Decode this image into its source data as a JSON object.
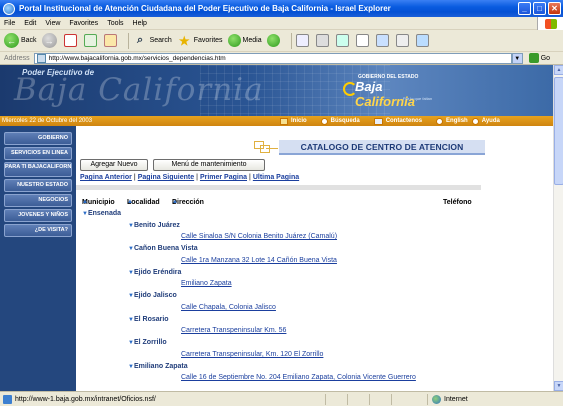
{
  "window": {
    "title": "Portal Institucional de Atención Ciudadana del Poder Ejecutivo de Baja California - Israel Explorer",
    "controls": {
      "minimize": "_",
      "maximize": "□",
      "close": "✕"
    }
  },
  "menu": [
    "File",
    "Edit",
    "View",
    "Favorites",
    "Tools",
    "Help"
  ],
  "toolbar": {
    "back": "Back",
    "search": "Search",
    "favorites": "Favorites",
    "media": "Media"
  },
  "address": {
    "label": "Address",
    "url": "http://www.bajacalifornia.gob.mx/servicios_dependencias.htm",
    "go": "Go"
  },
  "banner": {
    "subtitle": "Poder Ejecutivo de",
    "bg_text": "Baja California",
    "logo_gob": "GOBIERNO DEL ESTADO",
    "logo_baja": "Baja",
    "logo_california": "California",
    "logo_tag": "Por lo que faltan"
  },
  "navstrip": {
    "date": "Miercoles 22 de Octubre del 2003",
    "items": [
      "Inicio",
      "Búsqueda",
      "Contactenos",
      "English",
      "Ayuda"
    ]
  },
  "sidebar": [
    "GOBIERNO",
    "SERVICIOS EN LINEA",
    "PARA TI BAJACALIFORNIANO",
    "NUESTRO ESTADO",
    "NEGOCIOS",
    "JOVENES Y NIÑOS",
    "¿DE VISITA?"
  ],
  "catalog_title": "CATALOGO DE CENTRO DE ATENCION",
  "buttons": {
    "add": "Agregar Nuevo",
    "menu": "Menú de mantenimiento"
  },
  "pagination": {
    "prev": "Pagina Anterior",
    "next": "Pagina Siguiente",
    "first": "Primer Pagina",
    "last": "Ultima Pagina",
    "sep": "|"
  },
  "columns": {
    "municipio": "Municipio",
    "localidad": "Localidad",
    "direccion": "Dirección",
    "telefono": "Teléfono"
  },
  "tree": {
    "municipio": "Ensenada",
    "localidades": [
      {
        "name": "Benito Juárez",
        "address": "Calle Sinaloa S/N Colonia Benito Juárez (Camalú)"
      },
      {
        "name": "Cañon Buena Vista",
        "address": "Calle 1ra Manzana 32 Lote 14 Cañón Buena Vista"
      },
      {
        "name": "Ejido Eréndira",
        "address": "Emiliano Zapata"
      },
      {
        "name": "Ejido Jalisco",
        "address": "Calle Chapala, Colonia Jalisco"
      },
      {
        "name": "El Rosario",
        "address": "Carretera Transpeninsular Km. 56"
      },
      {
        "name": "El Zorrillo",
        "address": "Carretera Transpeninsular, Km. 120 El Zorrillo"
      },
      {
        "name": "Emiliano Zapata",
        "address": "Calle 16 de Septiembre No. 204 Emiliano Zapata, Colonia Vicente Guerrero"
      }
    ]
  },
  "status": {
    "text": "http://www-1.baja.gob.mx/intranet/Oficios.nsf/",
    "zone": "Internet"
  },
  "colors": {
    "accent_orange": "#d98e16",
    "sidebar_blue": "#24477e",
    "link_blue": "#1b3f9e"
  }
}
